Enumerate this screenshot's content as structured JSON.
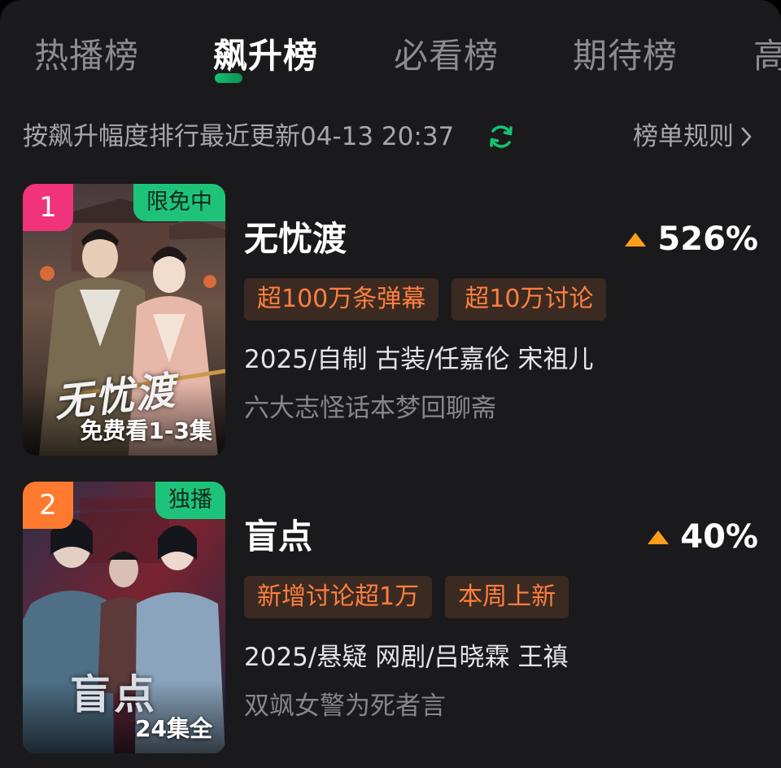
{
  "tabs": [
    {
      "label": "热播榜",
      "active": false
    },
    {
      "label": "飙升榜",
      "active": true
    },
    {
      "label": "必看榜",
      "active": false
    },
    {
      "label": "期待榜",
      "active": false
    },
    {
      "label": "高",
      "active": false
    }
  ],
  "subheader": {
    "description": "按飙升幅度排行最近更新04-13 20:37",
    "refresh_icon": "refresh-icon",
    "rules_label": "榜单规则",
    "rules_icon": "chevron-right-icon"
  },
  "colors": {
    "accent_green": "#16c172",
    "growth_arrow": "#ff9e1a",
    "tag_text": "#ff7f3f",
    "tag_bg": "#3b2a21",
    "rank1": "#f0337a",
    "rank2": "#ff7a2e"
  },
  "items": [
    {
      "rank": "1",
      "corner_tag": "限免中",
      "poster_title": "无忧渡",
      "poster_foot": "免费看1-3集",
      "title": "无忧渡",
      "growth": "526%",
      "tags": [
        "超100万条弹幕",
        "超10万讨论"
      ],
      "meta": "2025/自制 古装/任嘉伦 宋祖儿",
      "description": "六大志怪话本梦回聊斋"
    },
    {
      "rank": "2",
      "corner_tag": "独播",
      "poster_title": "盲点",
      "poster_foot": "24集全",
      "title": "盲点",
      "growth": "40%",
      "tags": [
        "新增讨论超1万",
        "本周上新"
      ],
      "meta": "2025/悬疑 网剧/吕晓霖 王禛",
      "description": "双飒女警为死者言"
    }
  ]
}
